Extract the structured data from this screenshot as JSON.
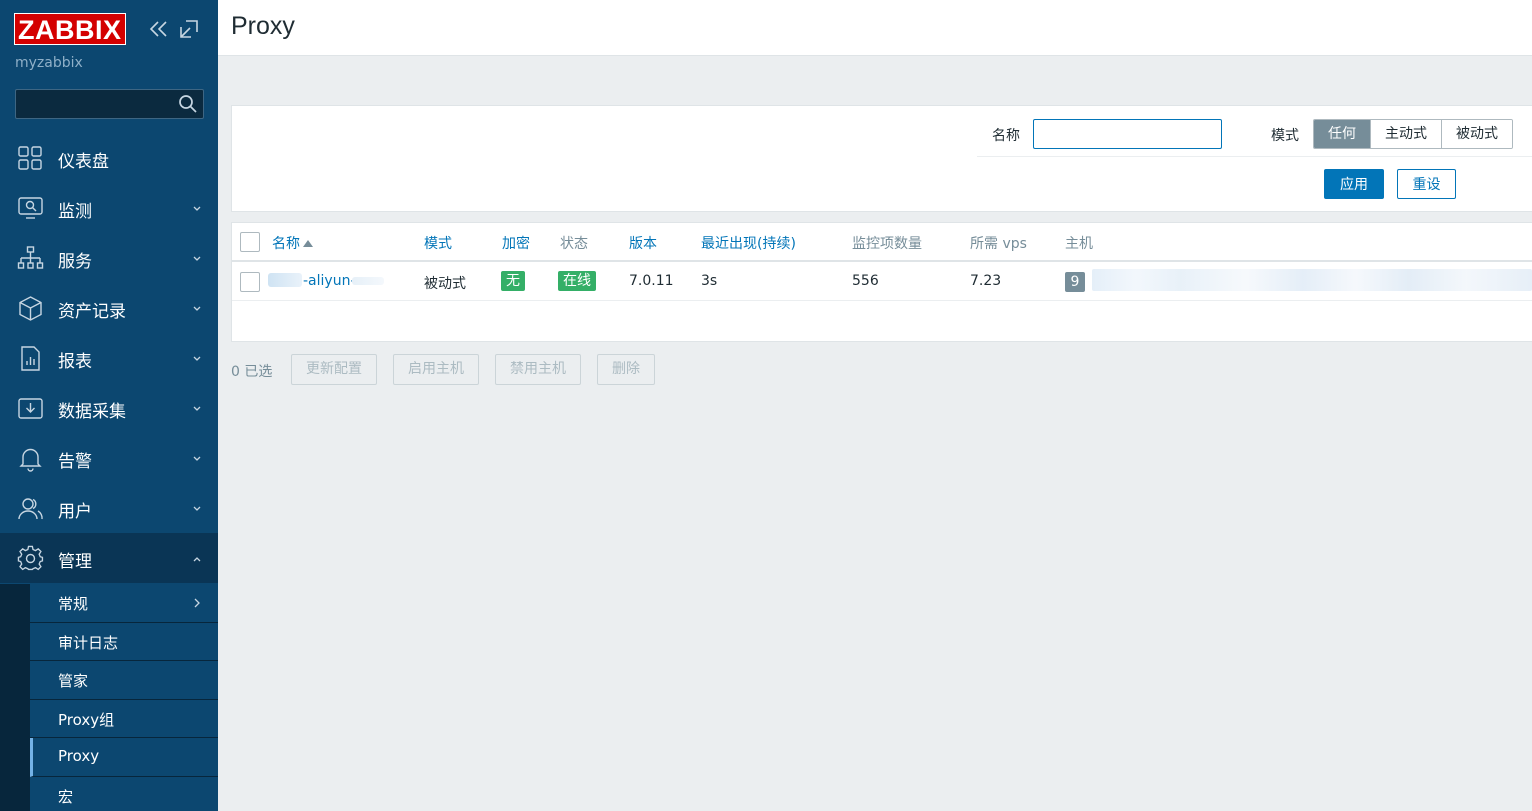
{
  "sidebar": {
    "logo": "ZABBIX",
    "instance": "myzabbix",
    "search": {
      "value": "",
      "placeholder": ""
    },
    "menu": [
      {
        "label": "仪表盘",
        "icon": "dashboard-icon"
      },
      {
        "label": "监测",
        "icon": "monitoring-icon"
      },
      {
        "label": "服务",
        "icon": "services-icon"
      },
      {
        "label": "资产记录",
        "icon": "inventory-icon"
      },
      {
        "label": "报表",
        "icon": "reports-icon"
      },
      {
        "label": "数据采集",
        "icon": "data-collection-icon"
      },
      {
        "label": "告警",
        "icon": "alerts-icon"
      },
      {
        "label": "用户",
        "icon": "users-icon"
      },
      {
        "label": "管理",
        "icon": "gear-icon"
      }
    ],
    "submenu": [
      {
        "label": "常规"
      },
      {
        "label": "审计日志"
      },
      {
        "label": "管家"
      },
      {
        "label": "Proxy组"
      },
      {
        "label": "Proxy"
      },
      {
        "label": "宏"
      }
    ]
  },
  "header": {
    "title": "Proxy"
  },
  "filter": {
    "name_label": "名称",
    "name_value": "",
    "mode_label": "模式",
    "modes": [
      "任何",
      "主动式",
      "被动式"
    ],
    "active_mode": "任何",
    "apply": "应用",
    "reset": "重设"
  },
  "table": {
    "columns": [
      "名称",
      "模式",
      "加密",
      "状态",
      "版本",
      "最近出现(持续)",
      "监控项数量",
      "所需 vps",
      "主机"
    ],
    "rows": [
      {
        "name": "-aliyun-",
        "mode": "被动式",
        "encryption": "无",
        "state": "在线",
        "version": "7.0.11",
        "last_seen": "3s",
        "items": "556",
        "vps": "7.23",
        "host_count": "9"
      }
    ]
  },
  "bulk": {
    "selected": "0 已选",
    "buttons": [
      "更新配置",
      "启用主机",
      "禁用主机",
      "删除"
    ]
  },
  "colors": {
    "sidebar": "#0c4770",
    "accent": "#0275b8",
    "online": "#34af67",
    "logo": "#d40000"
  }
}
